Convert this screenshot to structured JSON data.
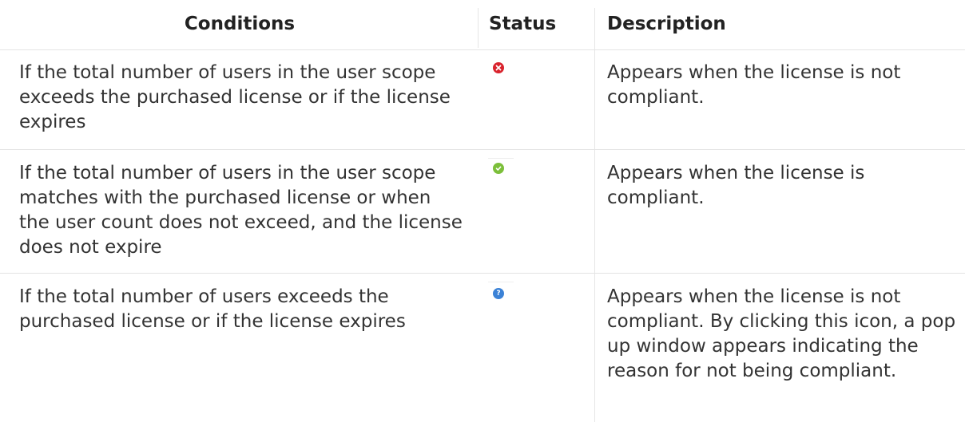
{
  "table": {
    "headers": {
      "conditions": "Conditions",
      "status": "Status",
      "description": "Description"
    },
    "rows": [
      {
        "condition": "If the total number of users in the user scope exceeds the purchased license or if the license expires",
        "status_icon": "error-x-icon",
        "status_color": "#d9232d",
        "description": "Appears when the license is not compliant."
      },
      {
        "condition": "If the total number of users in the user scope matches with the purchased license or when the user count does not exceed, and the license does not expire",
        "status_icon": "check-icon",
        "status_color": "#7cbf3a",
        "description": "Appears when the license is compliant."
      },
      {
        "condition": "If the total number of users exceeds the purchased license or if the license expires",
        "status_icon": "question-icon",
        "status_color": "#3b82d6",
        "description": "Appears when the license is not compliant. By clicking this icon, a pop up window appears indicating the reason for not being compliant."
      }
    ]
  }
}
